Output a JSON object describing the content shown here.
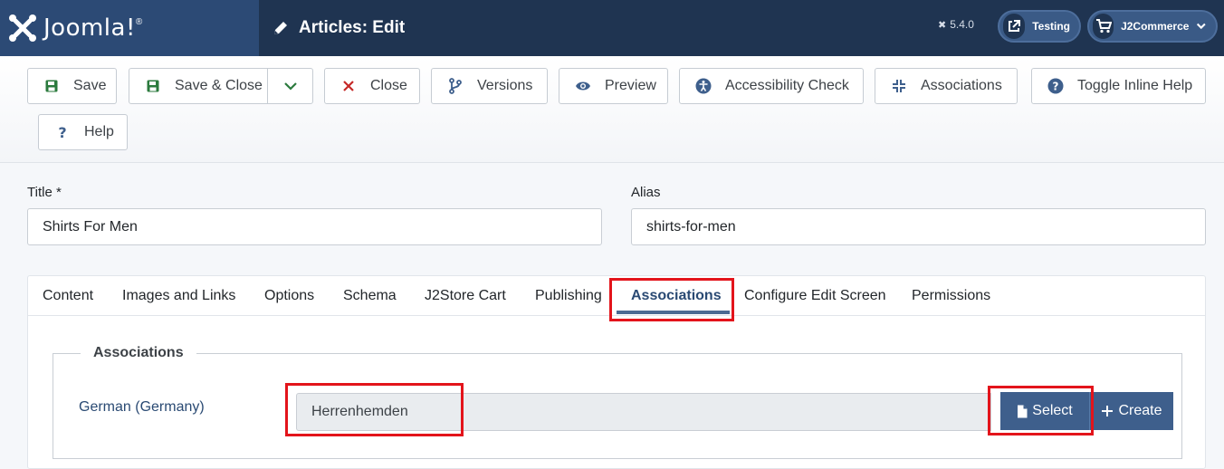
{
  "header": {
    "logo_text": "Joomla!",
    "logo_reg": "®",
    "page_title": "Articles: Edit",
    "version": "5.4.0",
    "testing_label": "Testing",
    "j2commerce_label": "J2Commerce"
  },
  "toolbar": {
    "save": "Save",
    "save_close": "Save & Close",
    "close": "Close",
    "versions": "Versions",
    "preview": "Preview",
    "accessibility": "Accessibility Check",
    "associations": "Associations",
    "toggle_help": "Toggle Inline Help",
    "help": "Help"
  },
  "form": {
    "title_label": "Title *",
    "title_value": "Shirts For Men",
    "alias_label": "Alias",
    "alias_value": "shirts-for-men"
  },
  "tabs": [
    {
      "label": "Content"
    },
    {
      "label": "Images and Links"
    },
    {
      "label": "Options"
    },
    {
      "label": "Schema"
    },
    {
      "label": "J2Store Cart"
    },
    {
      "label": "Publishing"
    },
    {
      "label": "Associations"
    },
    {
      "label": "Configure Edit Screen"
    },
    {
      "label": "Permissions"
    }
  ],
  "associations_panel": {
    "legend": "Associations",
    "language_label": "German (Germany)",
    "associated_item": "Herrenhemden",
    "select_button": "Select",
    "create_button": "Create"
  },
  "colors": {
    "header_bg": "#1f3451",
    "logo_bg": "#2c4a75",
    "accent": "#3e5f8c",
    "highlight": "#e3141b",
    "save_icon": "#2b7a3d",
    "close_icon": "#c52827"
  },
  "icons": {
    "save": "floppy-icon",
    "close": "x-icon",
    "versions": "branch-icon",
    "preview": "eye-icon",
    "accessibility": "universal-access-icon",
    "associations": "compress-icon",
    "toggle_help": "question-circle-icon",
    "help": "question-icon",
    "select": "file-icon",
    "create": "plus-icon"
  }
}
